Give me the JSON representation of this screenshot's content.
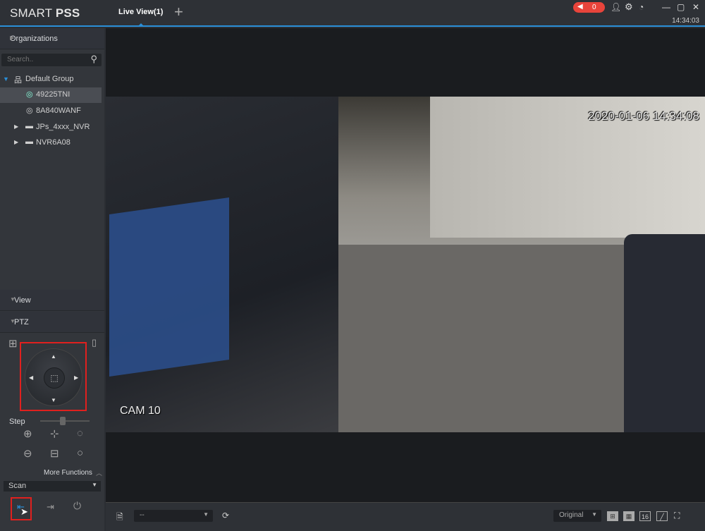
{
  "app": {
    "logo_light": "SMART ",
    "logo_bold": "PSS",
    "tab": "Live View(1)",
    "add_tab": "+",
    "alarm_count": "0",
    "clock": "14:34:03"
  },
  "sidebar": {
    "organizations": "Organizations",
    "search_placeholder": "Search..",
    "tree": [
      {
        "label": "Default Group",
        "icon": "group-icon"
      },
      {
        "label": "49225TNI",
        "icon": "camera-online-icon",
        "selected": true
      },
      {
        "label": "8A840WANF",
        "icon": "camera-icon"
      },
      {
        "label": "JPs_4xxx_NVR",
        "icon": "nvr-icon"
      },
      {
        "label": "NVR6A08",
        "icon": "nvr-icon"
      }
    ],
    "view": "View",
    "ptz": "PTZ",
    "step": "Step",
    "step_value": 0.45,
    "more_functions": "More Functions",
    "function_select": "Scan"
  },
  "video": {
    "timestamp": "2020-01-06 14:34:08",
    "camera_label": "CAM 10"
  },
  "bottom": {
    "stream_select": "--",
    "scale_select": "Original",
    "layout_16": "16"
  },
  "colors": {
    "accent": "#2a8fd8",
    "alarm": "#e8443b",
    "highlight": "#e0201e"
  }
}
